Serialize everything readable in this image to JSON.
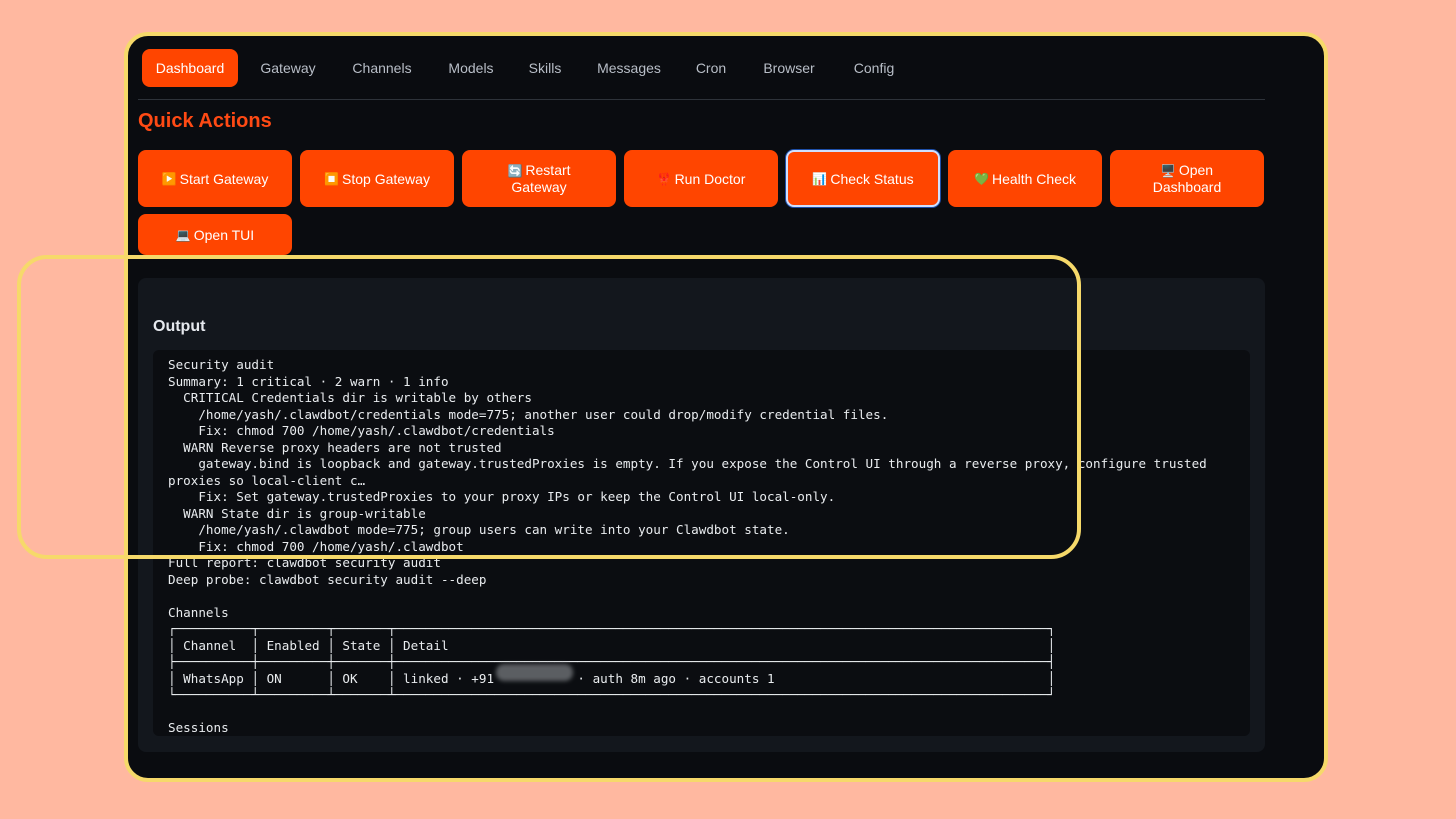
{
  "nav": {
    "tabs": [
      "Dashboard",
      "Gateway",
      "Channels",
      "Models",
      "Skills",
      "Messages",
      "Cron",
      "Browser",
      "Config"
    ],
    "active": "Dashboard"
  },
  "quick_actions": {
    "title": "Quick Actions",
    "buttons": [
      {
        "icon": "▶️",
        "label": "Start Gateway"
      },
      {
        "icon": "⏹️",
        "label": "Stop Gateway"
      },
      {
        "icon": "🔄",
        "label": "Restart Gateway"
      },
      {
        "icon": "🦞",
        "label": "Run Doctor"
      },
      {
        "icon": "📊",
        "label": "Check Status"
      },
      {
        "icon": "💚",
        "label": "Health Check"
      },
      {
        "icon": "🖥️",
        "label": "Open Dashboard"
      },
      {
        "icon": "💻",
        "label": "Open TUI"
      }
    ]
  },
  "output": {
    "title": "Output",
    "lines": [
      "Security audit",
      "Summary: 1 critical · 2 warn · 1 info",
      "  CRITICAL Credentials dir is writable by others",
      "    /home/yash/.clawdbot/credentials mode=775; another user could drop/modify credential files.",
      "    Fix: chmod 700 /home/yash/.clawdbot/credentials",
      "  WARN Reverse proxy headers are not trusted",
      "    gateway.bind is loopback and gateway.trustedProxies is empty. If you expose the Control UI through a reverse proxy, configure trusted",
      "proxies so local-client c…",
      "    Fix: Set gateway.trustedProxies to your proxy IPs or keep the Control UI local-only.",
      "  WARN State dir is group-writable",
      "    /home/yash/.clawdbot mode=775; group users can write into your Clawdbot state.",
      "    Fix: chmod 700 /home/yash/.clawdbot",
      "Full report: clawdbot security audit",
      "Deep probe: clawdbot security audit --deep",
      "",
      "Channels",
      "┌──────────┬─────────┬───────┬──────────────────────────────────────────────────────────────────────────────────────┐",
      "│ Channel  │ Enabled │ State │ Detail                                                                               │",
      "├──────────┼─────────┼───────┼──────────────────────────────────────────────────────────────────────────────────────┤",
      "│ WhatsApp │ ON      │ OK    │ linked · +91           · auth 8m ago · accounts 1                                    │",
      "└──────────┴─────────┴───────┴──────────────────────────────────────────────────────────────────────────────────────┘",
      "",
      "Sessions"
    ]
  }
}
